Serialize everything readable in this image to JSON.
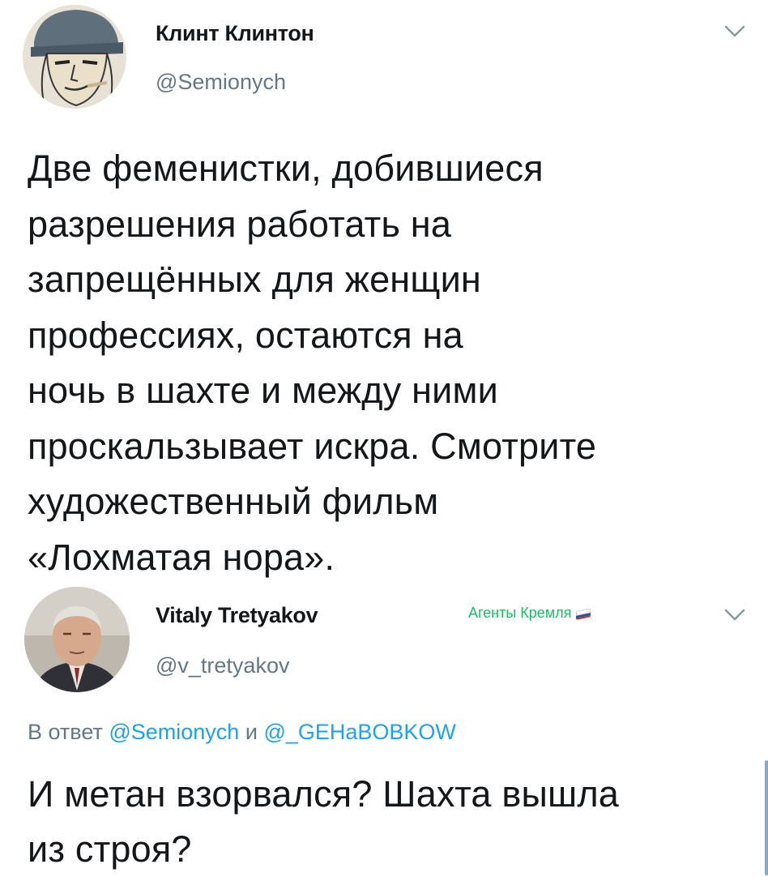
{
  "tweet1": {
    "author_name": "Клинт Клинтон",
    "author_handle": "@Semionych",
    "text": "Две феменистки, добившиеся\nразрешения работать на\nзапрещённых для женщин\nпрофессиях, остаются на\nночь в шахте и между ними\nпроскальзывает искра. Смотрите\nхудожественный фильм\n«Лохматая нора».",
    "menu_icon": "chevron-down-icon"
  },
  "tweet2": {
    "author_name": "Vitaly Tretyakov",
    "author_handle": "@v_tretyakov",
    "badge_label": "Агенты Кремля",
    "badge_icon": "russian-flag-icon",
    "reply_prefix": "В ответ",
    "reply_mention_1": "@Semionych",
    "reply_joiner": "и",
    "reply_mention_2": "@_GEHaBOBKOW",
    "text": "И метан взорвался? Шахта вышла\nиз строя?",
    "menu_icon": "chevron-down-icon"
  },
  "colors": {
    "name": "#14171a",
    "secondary": "#657786",
    "link": "#1da1f2",
    "badge": "#17bf63"
  }
}
